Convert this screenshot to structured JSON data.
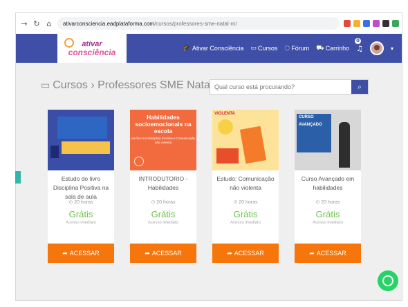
{
  "browser": {
    "url_host": "ativarconsciencia.eadplataforma.com",
    "url_path": "/cursos/professores-sme-natal-rn/"
  },
  "navbar": {
    "logo_top": "ativar",
    "logo_bottom": "consciência",
    "links": [
      {
        "icon": "graduation-icon",
        "label": "Ativar Consciência"
      },
      {
        "icon": "laptop-icon",
        "label": "Cursos"
      },
      {
        "icon": "forum-icon",
        "label": "Fórum"
      },
      {
        "icon": "cart-icon",
        "label": "Carrinho"
      }
    ],
    "notifications_count": "0"
  },
  "page": {
    "heading": "Cursos › Professores SME Natal RN",
    "search_placeholder": "Qual curso está procurando?"
  },
  "courses": [
    {
      "title": "Estudo do livro Disciplina Positiva na sala de aula",
      "hours": "⊙ 20 horas",
      "price": "Grátis",
      "access": "Acesso imediato",
      "button": "ACESSAR",
      "thumb_text": ""
    },
    {
      "title": "INTRODUTORIO - Habilidades",
      "hours": "⊙ 20 horas",
      "price": "Grátis",
      "access": "Acesso imediato",
      "button": "ACESSAR",
      "thumb_headline": "Habilidades socioemocionais na escola",
      "thumb_sub": "um foco na Disciplina Positiva e Comunicação não violenta"
    },
    {
      "title": "Estudo: Comunicação não violenta",
      "hours": "⊙ 20 horas",
      "price": "Grátis",
      "access": "Acesso imediato",
      "button": "ACESSAR",
      "thumb_label": "VIOLENTA"
    },
    {
      "title": "Curso Avançado em habilidades",
      "hours": "⊙ 20 horas",
      "price": "Grátis",
      "access": "Acesso imediato",
      "button": "ACESSAR",
      "thumb_label_1": "CURSO",
      "thumb_label_2": "AVANÇADO"
    }
  ],
  "colors": {
    "navbar": "#3f4fa8",
    "button": "#f7760c",
    "price": "#6cc24a",
    "whatsapp": "#25d366"
  }
}
